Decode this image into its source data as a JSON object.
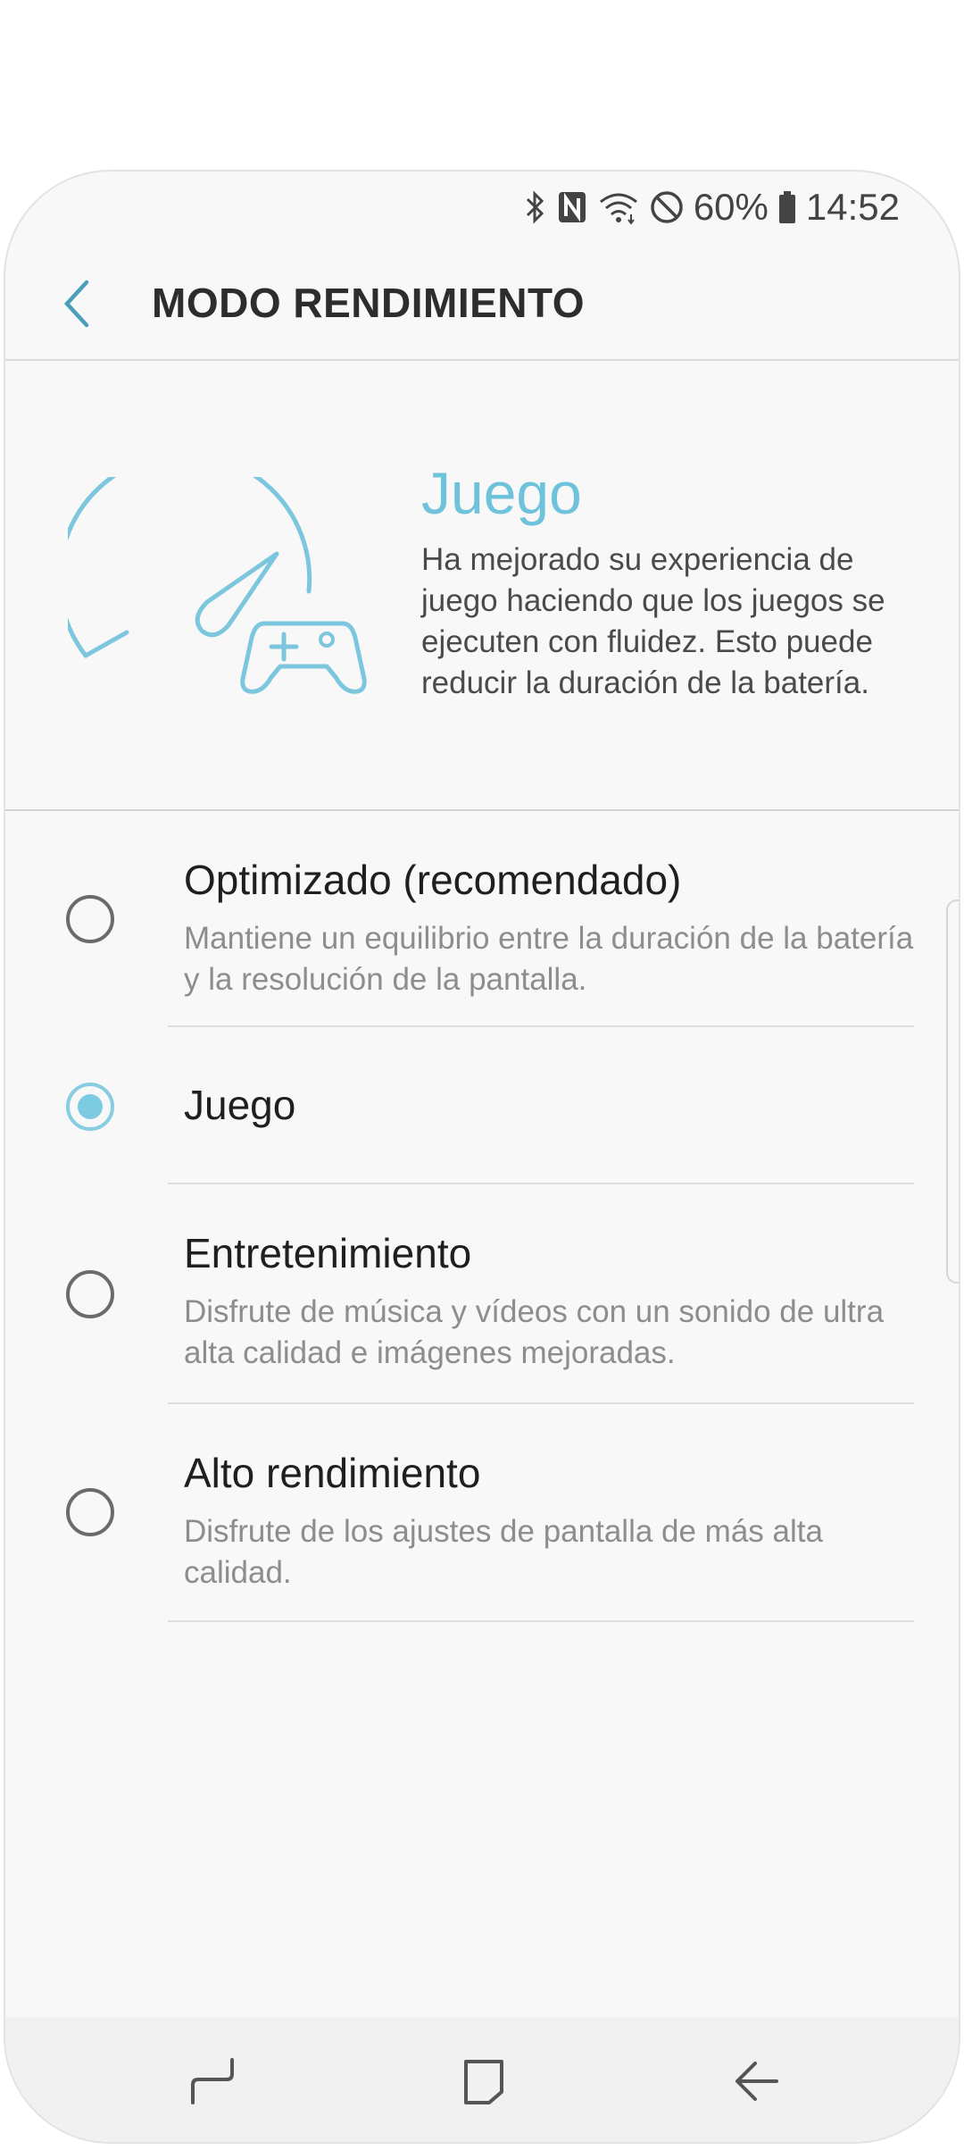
{
  "status_bar": {
    "battery_percent": "60%",
    "time": "14:52",
    "icons": [
      "bluetooth-icon",
      "nfc-icon",
      "wifi-icon",
      "do-not-disturb-icon",
      "battery-icon"
    ]
  },
  "header": {
    "title": "MODO RENDIMIENTO",
    "back_icon": "chevron-left-icon"
  },
  "hero": {
    "icon": "speedometer-gamepad-icon",
    "title": "Juego",
    "description": "Ha mejorado su experiencia de juego haciendo que los juegos se ejecuten con fluidez. Esto puede reducir la duración de la batería."
  },
  "options": [
    {
      "title": "Optimizado (recomendado)",
      "description": "Mantiene un equilibrio entre la duración de la batería y la resolución de la pantalla.",
      "selected": false
    },
    {
      "title": "Juego",
      "description": "",
      "selected": true
    },
    {
      "title": "Entretenimiento",
      "description": "Disfrute de música y vídeos con un sonido de ultra alta calidad e imágenes mejoradas.",
      "selected": false
    },
    {
      "title": "Alto rendimiento",
      "description": "Disfrute de los ajustes de pantalla de más alta calidad.",
      "selected": false
    }
  ],
  "nav_bar": {
    "icons": [
      "recent-apps-icon",
      "home-icon",
      "back-icon"
    ]
  },
  "colors": {
    "accent": "#6fc2db",
    "background": "#f8f8f8",
    "title_text": "#2d2d2d",
    "secondary_text": "#8d8d8d"
  }
}
